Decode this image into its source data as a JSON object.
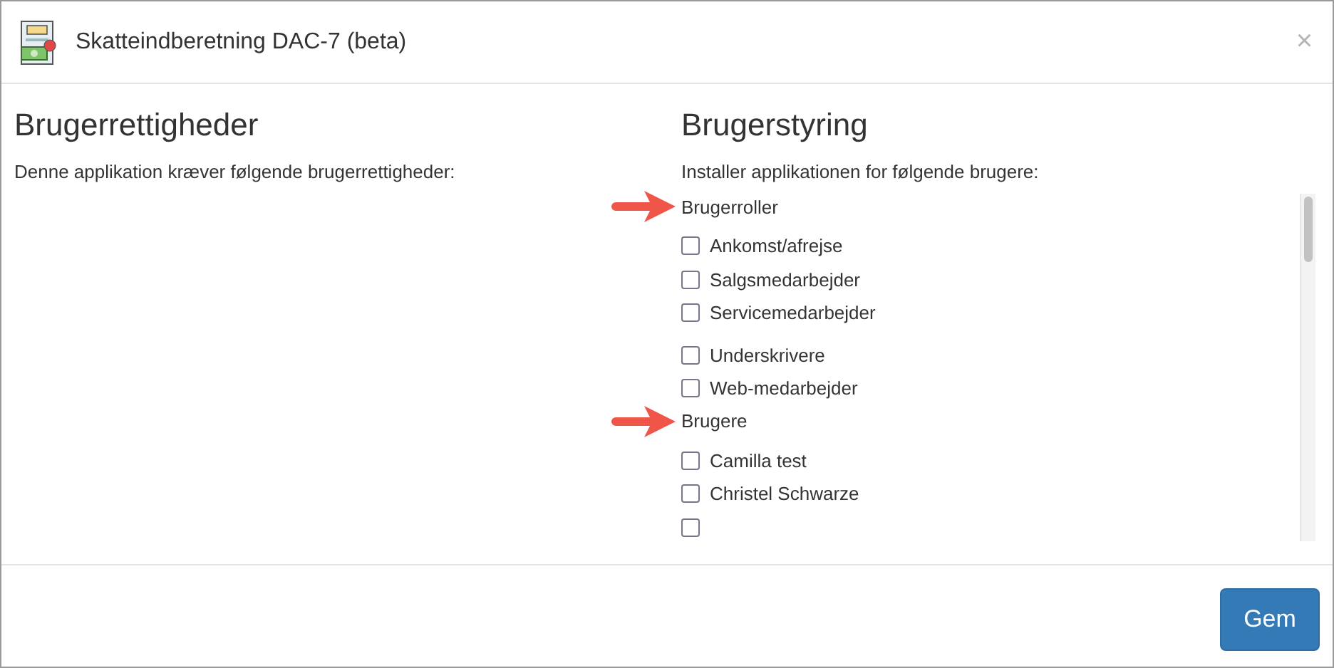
{
  "dialog": {
    "title": "Skatteindberetning DAC-7 (beta)",
    "close": "×"
  },
  "permissions": {
    "heading": "Brugerrettigheder",
    "text": "Denne applikation kræver følgende brugerrettigheder:"
  },
  "user_management": {
    "heading": "Brugerstyring",
    "text": "Installer applikationen for følgende brugere:",
    "groups": [
      {
        "label": "Brugerroller",
        "blocks": [
          {
            "items": [
              {
                "label": "Ankomst/afrejse",
                "checked": false
              },
              {
                "label": "Salgsmedarbejder",
                "checked": false
              },
              {
                "label": "Servicemedarbejder",
                "checked": false
              }
            ]
          },
          {
            "items": [
              {
                "label": "Underskrivere",
                "checked": false
              },
              {
                "label": "Web-medarbejder",
                "checked": false
              }
            ]
          }
        ]
      },
      {
        "label": "Brugere",
        "blocks": [
          {
            "items": [
              {
                "label": "Camilla test",
                "checked": false
              },
              {
                "label": "Christel Schwarze",
                "checked": false
              },
              {
                "checked": false
              }
            ]
          }
        ]
      }
    ]
  },
  "footer": {
    "save_button": "Gem"
  }
}
